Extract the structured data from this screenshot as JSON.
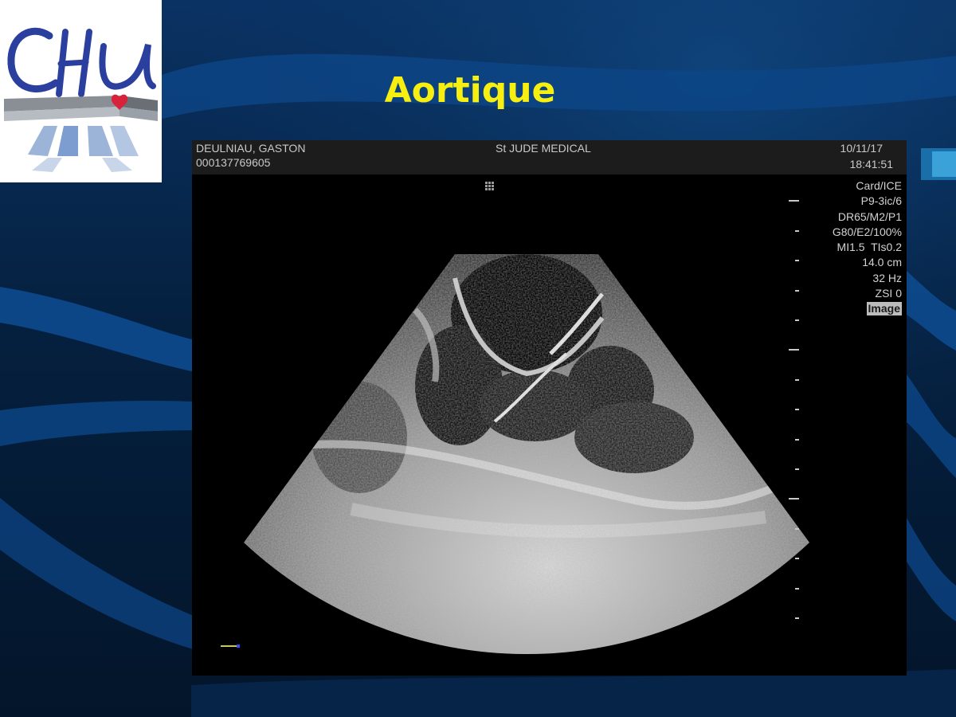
{
  "slide": {
    "title": "Aortique"
  },
  "logo": {
    "text": "CHU"
  },
  "ultrasound": {
    "patient_name": "DEULNIAU, GASTON",
    "patient_id": "000137769605",
    "vendor": "St JUDE MEDICAL",
    "date": "10/11/17",
    "time": "18:41:51",
    "parameters": {
      "preset": "Card/ICE",
      "probe": "P9-3ic/6",
      "dynamic": "DR65/M2/P1",
      "gain": "G80/E2/100%",
      "mi_tis": "MI1.5  TIs0.2",
      "depth": "14.0 cm",
      "frame_rate": "32 Hz",
      "zoom": "ZSI 0",
      "mode": "Image"
    }
  },
  "colors": {
    "background": "#04182f",
    "wave": "#0b4a8a",
    "title": "#f7ef10",
    "logo_blue": "#2a3f9e",
    "logo_heart": "#d8213a"
  }
}
